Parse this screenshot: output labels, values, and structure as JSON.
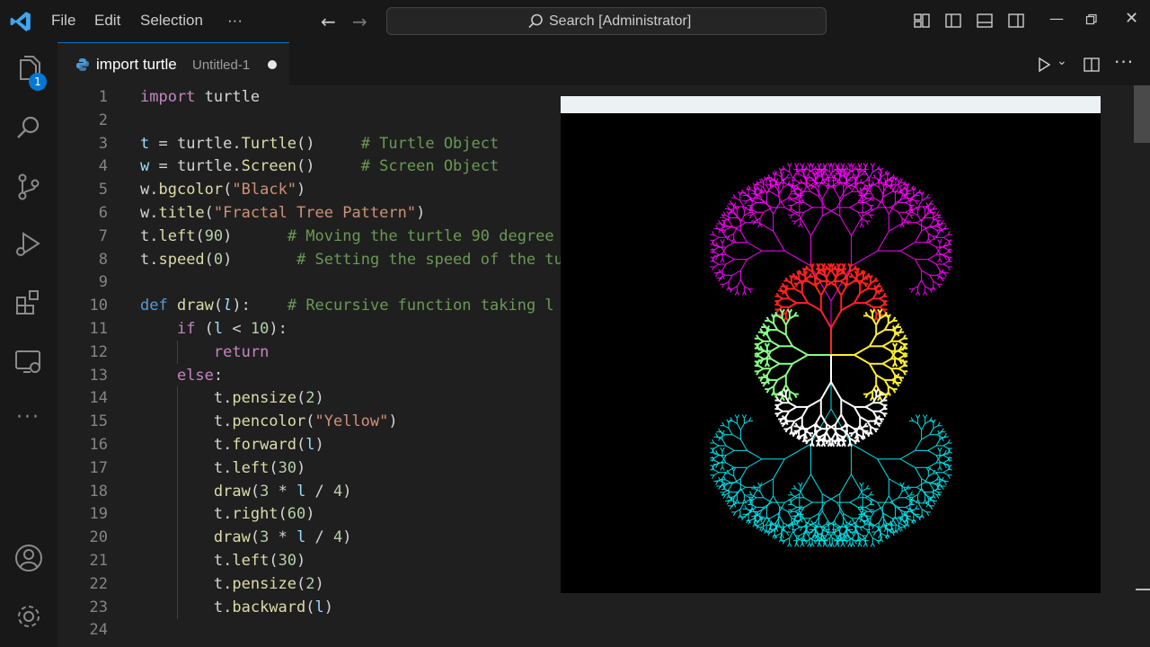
{
  "titlebar": {
    "menus": [
      "File",
      "Edit",
      "Selection",
      "···"
    ],
    "search_text": "Search [Administrator]",
    "icons": [
      "layout-icon",
      "toggle-primary-sidebar-icon",
      "toggle-panel-icon",
      "toggle-secondary-sidebar-icon"
    ],
    "window_buttons": [
      "minimize",
      "restore",
      "close"
    ]
  },
  "activity_bar": {
    "items": [
      "explorer-icon",
      "search-icon",
      "source-control-icon",
      "run-debug-icon",
      "extensions-icon",
      "remote-explorer-icon",
      "more-icon",
      "account-icon",
      "settings-gear-icon"
    ],
    "explorer_badge": "1"
  },
  "tab": {
    "title": "import turtle",
    "description": "Untitled-1",
    "modified": true
  },
  "editor": {
    "lines": [
      {
        "n": "1"
      },
      {
        "n": "2"
      },
      {
        "n": "3"
      },
      {
        "n": "4"
      },
      {
        "n": "5"
      },
      {
        "n": "6"
      },
      {
        "n": "7"
      },
      {
        "n": "8"
      },
      {
        "n": "9"
      },
      {
        "n": "10"
      },
      {
        "n": "11"
      },
      {
        "n": "12"
      },
      {
        "n": "13"
      },
      {
        "n": "14"
      },
      {
        "n": "15"
      },
      {
        "n": "16"
      },
      {
        "n": "17"
      },
      {
        "n": "18"
      },
      {
        "n": "19"
      },
      {
        "n": "20"
      },
      {
        "n": "21"
      },
      {
        "n": "22"
      },
      {
        "n": "23"
      },
      {
        "n": "24"
      }
    ],
    "code": [
      [
        [
          "kw",
          "import"
        ],
        [
          "plain",
          " turtle"
        ]
      ],
      [],
      [
        [
          "var",
          "t"
        ],
        [
          "op",
          " = "
        ],
        [
          "plain",
          "turtle."
        ],
        [
          "fn",
          "Turtle"
        ],
        [
          "plain",
          "()     "
        ],
        [
          "com",
          "# Turtle Object"
        ]
      ],
      [
        [
          "var",
          "w"
        ],
        [
          "op",
          " = "
        ],
        [
          "plain",
          "turtle."
        ],
        [
          "fn",
          "Screen"
        ],
        [
          "plain",
          "()     "
        ],
        [
          "com",
          "# Screen Object"
        ]
      ],
      [
        [
          "plain",
          "w."
        ],
        [
          "fn",
          "bgcolor"
        ],
        [
          "plain",
          "("
        ],
        [
          "str",
          "\"Black\""
        ],
        [
          "plain",
          ")"
        ]
      ],
      [
        [
          "plain",
          "w."
        ],
        [
          "fn",
          "title"
        ],
        [
          "plain",
          "("
        ],
        [
          "str",
          "\"Fractal Tree Pattern\""
        ],
        [
          "plain",
          ")"
        ]
      ],
      [
        [
          "plain",
          "t."
        ],
        [
          "fn",
          "left"
        ],
        [
          "plain",
          "("
        ],
        [
          "num",
          "90"
        ],
        [
          "plain",
          ")      "
        ],
        [
          "com",
          "# Moving the turtle 90 degree"
        ]
      ],
      [
        [
          "plain",
          "t."
        ],
        [
          "fn",
          "speed"
        ],
        [
          "plain",
          "("
        ],
        [
          "num",
          "0"
        ],
        [
          "plain",
          ")       "
        ],
        [
          "com",
          "# Setting the speed of the tu"
        ]
      ],
      [],
      [
        [
          "def",
          "def"
        ],
        [
          "plain",
          " "
        ],
        [
          "fn",
          "draw"
        ],
        [
          "plain",
          "("
        ],
        [
          "param",
          "l"
        ],
        [
          "plain",
          "):    "
        ],
        [
          "com",
          "# Recursive function taking l"
        ]
      ],
      [
        [
          "plain",
          "    "
        ],
        [
          "kw",
          "if"
        ],
        [
          "plain",
          " ("
        ],
        [
          "var",
          "l"
        ],
        [
          "op",
          " < "
        ],
        [
          "num",
          "10"
        ],
        [
          "plain",
          "):"
        ]
      ],
      [
        [
          "plain",
          "        "
        ],
        [
          "kw",
          "return"
        ]
      ],
      [
        [
          "plain",
          "    "
        ],
        [
          "kw",
          "else"
        ],
        [
          "plain",
          ":"
        ]
      ],
      [
        [
          "plain",
          "        t."
        ],
        [
          "fn",
          "pensize"
        ],
        [
          "plain",
          "("
        ],
        [
          "num",
          "2"
        ],
        [
          "plain",
          ")"
        ]
      ],
      [
        [
          "plain",
          "        t."
        ],
        [
          "fn",
          "pencolor"
        ],
        [
          "plain",
          "("
        ],
        [
          "str",
          "\"Yellow\""
        ],
        [
          "plain",
          ")"
        ]
      ],
      [
        [
          "plain",
          "        t."
        ],
        [
          "fn",
          "forward"
        ],
        [
          "plain",
          "("
        ],
        [
          "var",
          "l"
        ],
        [
          "plain",
          ")"
        ]
      ],
      [
        [
          "plain",
          "        t."
        ],
        [
          "fn",
          "left"
        ],
        [
          "plain",
          "("
        ],
        [
          "num",
          "30"
        ],
        [
          "plain",
          ")"
        ]
      ],
      [
        [
          "plain",
          "        "
        ],
        [
          "fn",
          "draw"
        ],
        [
          "plain",
          "("
        ],
        [
          "num",
          "3"
        ],
        [
          "op",
          " * "
        ],
        [
          "var",
          "l"
        ],
        [
          "op",
          " / "
        ],
        [
          "num",
          "4"
        ],
        [
          "plain",
          ")"
        ]
      ],
      [
        [
          "plain",
          "        t."
        ],
        [
          "fn",
          "right"
        ],
        [
          "plain",
          "("
        ],
        [
          "num",
          "60"
        ],
        [
          "plain",
          ")"
        ]
      ],
      [
        [
          "plain",
          "        "
        ],
        [
          "fn",
          "draw"
        ],
        [
          "plain",
          "("
        ],
        [
          "num",
          "3"
        ],
        [
          "op",
          " * "
        ],
        [
          "var",
          "l"
        ],
        [
          "op",
          " / "
        ],
        [
          "num",
          "4"
        ],
        [
          "plain",
          ")"
        ]
      ],
      [
        [
          "plain",
          "        t."
        ],
        [
          "fn",
          "left"
        ],
        [
          "plain",
          "("
        ],
        [
          "num",
          "30"
        ],
        [
          "plain",
          ")"
        ]
      ],
      [
        [
          "plain",
          "        t."
        ],
        [
          "fn",
          "pensize"
        ],
        [
          "plain",
          "("
        ],
        [
          "num",
          "2"
        ],
        [
          "plain",
          ")"
        ]
      ],
      [
        [
          "plain",
          "        t."
        ],
        [
          "fn",
          "backward"
        ],
        [
          "plain",
          "("
        ],
        [
          "var",
          "l"
        ],
        [
          "plain",
          ")"
        ]
      ],
      []
    ]
  },
  "turtle_window": {
    "background": "#000000",
    "tree_colors": [
      "#ff00ff",
      "#00e5ee",
      "#ff2222",
      "#ffee33",
      "#88ff88",
      "#ffffff"
    ]
  }
}
